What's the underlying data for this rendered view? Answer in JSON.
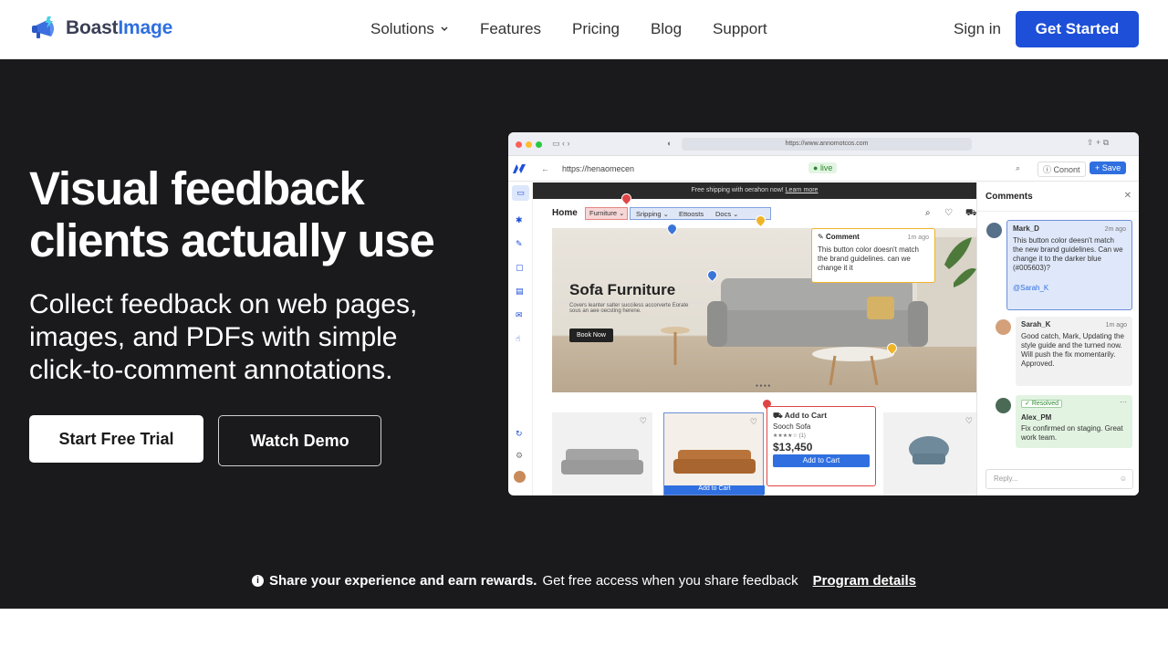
{
  "nav": {
    "logo_a": "Boast",
    "logo_b": "Image",
    "items": [
      "Solutions",
      "Features",
      "Pricing",
      "Blog",
      "Support"
    ],
    "signin": "Sign in",
    "cta": "Get Started"
  },
  "hero": {
    "title": "Visual feedback clients actually use",
    "subtitle": "Collect feedback on web pages, images, and PDFs with simple click-to-comment annotations.",
    "btn_primary": "Start Free Trial",
    "btn_secondary": "Watch Demo"
  },
  "banner": {
    "bold": "Share your experience and earn rewards.",
    "text": "Get free access when you share feedback",
    "link": "Program details"
  },
  "mock": {
    "browser_url": "https://www.annomotcos.com",
    "app_url": "https://henaomecen",
    "live": "live",
    "contact": "Conont",
    "save": "+ Save",
    "promo": "Free shipping with oerahon now!",
    "promo_link": "Learn more",
    "site_nav": [
      "Home",
      "Furniture",
      "Sripping",
      "Ettoosts",
      "Docs"
    ],
    "hero_title": "Sofa Furniture",
    "hero_text": "Covers leanter salter succiless accorverte Eorate sous an aee oecsting herene.",
    "hero_btn": "Book Now",
    "comment_title": "Comment",
    "comment_time": "1m ago",
    "comment_text": "This button color doesn't match the brand guidelines. can we change it it",
    "add_cart_title": "Add to Cart",
    "product": "Sooch Sofa",
    "rating_count": "(1)",
    "price": "$13,450",
    "add_btn": "Add to Cart",
    "add_btn2": "Add to Cart",
    "panel_title": "Comments",
    "comments": [
      {
        "user": "Mark_D",
        "time": "2m ago",
        "text": "This button color deesn't match the new brand guidelines. Can we change it to the darker blue (#005603)?",
        "mention": "@Sarah_K"
      },
      {
        "user": "Sarah_K",
        "time": "1m ago",
        "text": "Good catch, Mark, Updating the style guide and the turned now. Will push the fix momentarily. Approved."
      },
      {
        "user": "Alex_PM",
        "badge": "Resolved",
        "text": "Fix confirmed on staging. Great work team."
      }
    ],
    "reply": "Reply..."
  },
  "colors": {
    "accent": "#1d4fd8",
    "hero_bg": "#1a191b"
  }
}
